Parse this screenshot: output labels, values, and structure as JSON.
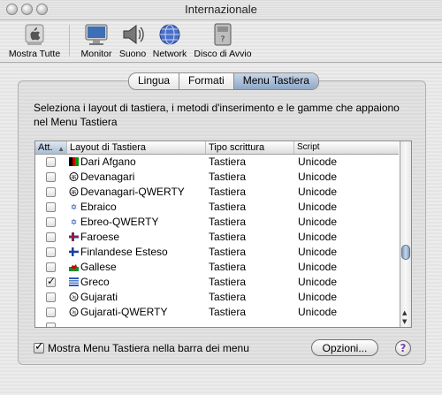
{
  "window": {
    "title": "Internazionale",
    "background_scrawl": ""
  },
  "toolbar": {
    "items": [
      {
        "label": "Mostra Tutte",
        "icon": "apple-show-all-icon"
      },
      {
        "label": "Monitor",
        "icon": "monitor-icon"
      },
      {
        "label": "Suono",
        "icon": "speaker-icon"
      },
      {
        "label": "Network",
        "icon": "globe-network-icon"
      },
      {
        "label": "Disco di Avvio",
        "icon": "startup-disk-icon"
      }
    ]
  },
  "tabs": [
    {
      "label": "Lingua",
      "active": false
    },
    {
      "label": "Formati",
      "active": false
    },
    {
      "label": "Menu Tastiera",
      "active": true
    }
  ],
  "description": "Seleziona i layout di tastiera, i metodi d'inserimento e le gamme che appaiono nel Menu Tastiera",
  "table": {
    "headers": {
      "att": "Att.",
      "layout": "Layout di Tastiera",
      "tipo": "Tipo scrittura",
      "script": "Script"
    },
    "rows": [
      {
        "checked": false,
        "name": "Dari Afgano",
        "tipo": "Tastiera",
        "script": "Unicode",
        "flag": "afghanistan-flag-icon"
      },
      {
        "checked": false,
        "name": "Devanagari",
        "tipo": "Tastiera",
        "script": "Unicode",
        "flag": "devanagari-icon"
      },
      {
        "checked": false,
        "name": "Devanagari-QWERTY",
        "tipo": "Tastiera",
        "script": "Unicode",
        "flag": "devanagari-icon"
      },
      {
        "checked": false,
        "name": "Ebraico",
        "tipo": "Tastiera",
        "script": "Unicode",
        "flag": "israel-flag-icon"
      },
      {
        "checked": false,
        "name": "Ebreo-QWERTY",
        "tipo": "Tastiera",
        "script": "Unicode",
        "flag": "israel-flag-icon"
      },
      {
        "checked": false,
        "name": "Faroese",
        "tipo": "Tastiera",
        "script": "Unicode",
        "flag": "faroe-flag-icon"
      },
      {
        "checked": false,
        "name": "Finlandese Esteso",
        "tipo": "Tastiera",
        "script": "Unicode",
        "flag": "finland-flag-icon"
      },
      {
        "checked": false,
        "name": "Gallese",
        "tipo": "Tastiera",
        "script": "Unicode",
        "flag": "wales-flag-icon"
      },
      {
        "checked": true,
        "name": "Greco",
        "tipo": "Tastiera",
        "script": "Unicode",
        "flag": "greece-flag-icon"
      },
      {
        "checked": false,
        "name": "Gujarati",
        "tipo": "Tastiera",
        "script": "Unicode",
        "flag": "gujarati-icon"
      },
      {
        "checked": false,
        "name": "Gujarati-QWERTY",
        "tipo": "Tastiera",
        "script": "Unicode",
        "flag": "gujarati-icon"
      },
      {
        "checked": false,
        "name": "",
        "tipo": "",
        "script": "",
        "flag": "partial-row"
      }
    ]
  },
  "footer": {
    "show_menu_label": "Mostra Menu Tastiera nella barra dei menu",
    "show_menu_checked": true,
    "options_button": "Opzioni...",
    "help_button": "?"
  }
}
